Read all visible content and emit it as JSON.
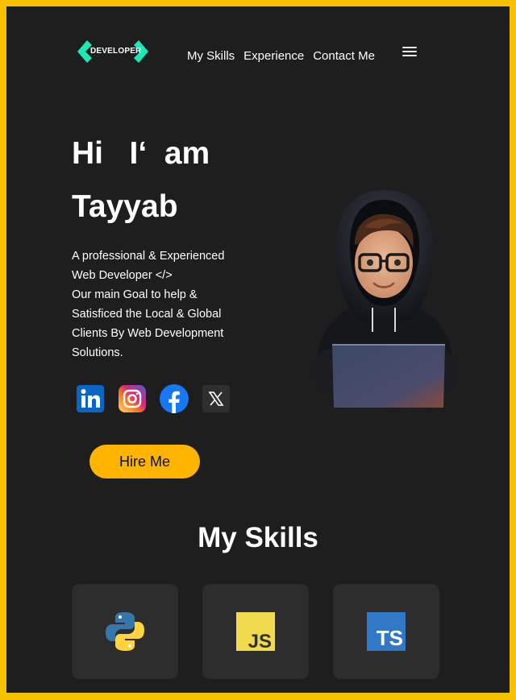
{
  "header": {
    "logo_text": "DEVELOPER",
    "nav": [
      "My Skills",
      "Experience",
      "Contact Me"
    ],
    "menu_icon": "hamburger-icon"
  },
  "hero": {
    "greeting": "Hi   I‘  am",
    "name": "Tayyab",
    "description": [
      "A professional & Experienced",
      "Web Developer </>",
      "Our main Goal to help &",
      "Satisficed the Local & Global",
      "Clients By Web Development",
      "Solutions."
    ],
    "socials": [
      "linkedin-icon",
      "instagram-icon",
      "facebook-icon",
      "x-icon"
    ],
    "cta": "Hire Me",
    "avatar": "developer-avatar"
  },
  "skills": {
    "title": "My Skills",
    "items": [
      "python-icon",
      "javascript-icon",
      "typescript-icon"
    ],
    "js_label": "JS",
    "ts_label": "TS"
  },
  "colors": {
    "page_border": "#f6c200",
    "background": "#1e1e1e",
    "accent": "#ffb400",
    "logo_green": "#1de9b6",
    "card": "#2d2d2d"
  }
}
